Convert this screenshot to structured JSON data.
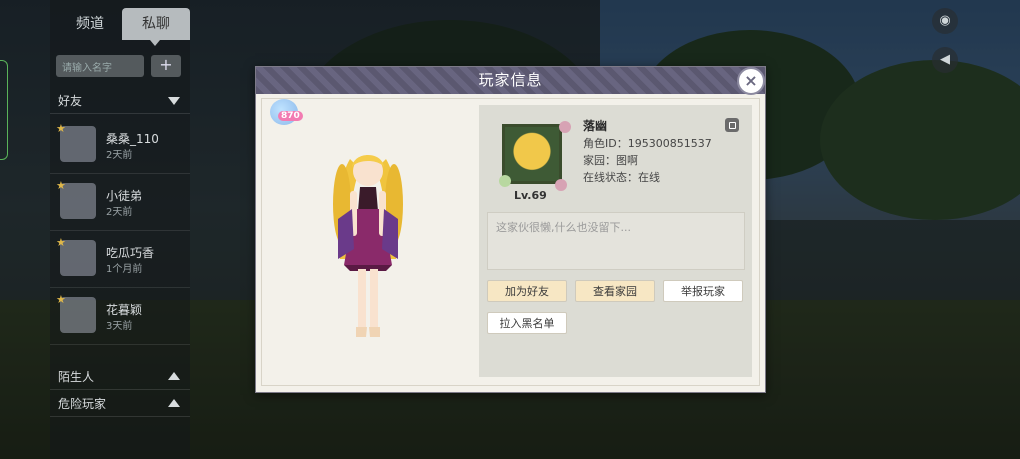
{
  "chat": {
    "tabs": [
      "频道",
      "私聊"
    ],
    "search_placeholder": "请输入名字",
    "add_button": "+",
    "groups": {
      "friends": "好友",
      "strangers": "陌生人",
      "dangerous": "危险玩家"
    },
    "friends": [
      {
        "name": "桑桑_110",
        "time": "2天前"
      },
      {
        "name": "小徒弟",
        "time": "2天前"
      },
      {
        "name": "吃瓜巧香",
        "time": "1个月前"
      },
      {
        "name": "花暮颖",
        "time": "3天前"
      }
    ]
  },
  "profile": {
    "title": "玩家信息",
    "close_icon": "×",
    "badge_number": "870",
    "nickname": "落幽",
    "role_id_label": "角色ID：",
    "role_id": "195300851537",
    "home_label": "家园：",
    "home": "图啊",
    "status_label": "在线状态：",
    "status": "在线",
    "level": "Lv.69",
    "signature": "这家伙很懒,什么也没留下...",
    "buttons": {
      "add_friend": "加为好友",
      "view_home": "查看家园",
      "report": "举报玩家",
      "blacklist": "拉入黑名单"
    }
  },
  "colors": {
    "header": "#5b5870",
    "warm_button": "#f7e7c4",
    "card_bg": "#dcdcd4",
    "star": "#e0b84a"
  },
  "icons": {
    "copy": "copy-icon",
    "close": "close-icon",
    "camera": "camera-icon",
    "megaphone": "megaphone-icon"
  }
}
